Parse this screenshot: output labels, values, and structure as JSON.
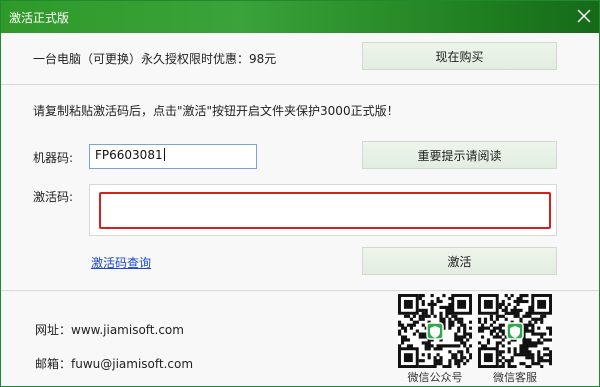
{
  "window": {
    "title": "激活正式版"
  },
  "purchase": {
    "price_text": "一台电脑（可更换）永久授权限时优惠：98元",
    "buy_label": "现在购买"
  },
  "activation": {
    "instruction": "请复制粘贴激活码后，点击\"激活\"按钮开启文件夹保护3000正式版！",
    "machine_label": "机器码:",
    "machine_code": "FP6603081",
    "notice_label": "重要提示请阅读",
    "code_label": "激活码:",
    "code_value": "",
    "query_link": "激活码查询",
    "activate_label": "激活"
  },
  "contact": {
    "site_text": "网址：www.jiamisoft.com",
    "email_text": "邮箱：fuwu@jiamisoft.com",
    "qr_public_label": "微信公众号",
    "qr_service_label": "微信客服"
  },
  "colors": {
    "title_bar": "#2f9a2a",
    "button_bg": "#e6efe4",
    "code_border": "#d62020",
    "link": "#1a49c9"
  }
}
